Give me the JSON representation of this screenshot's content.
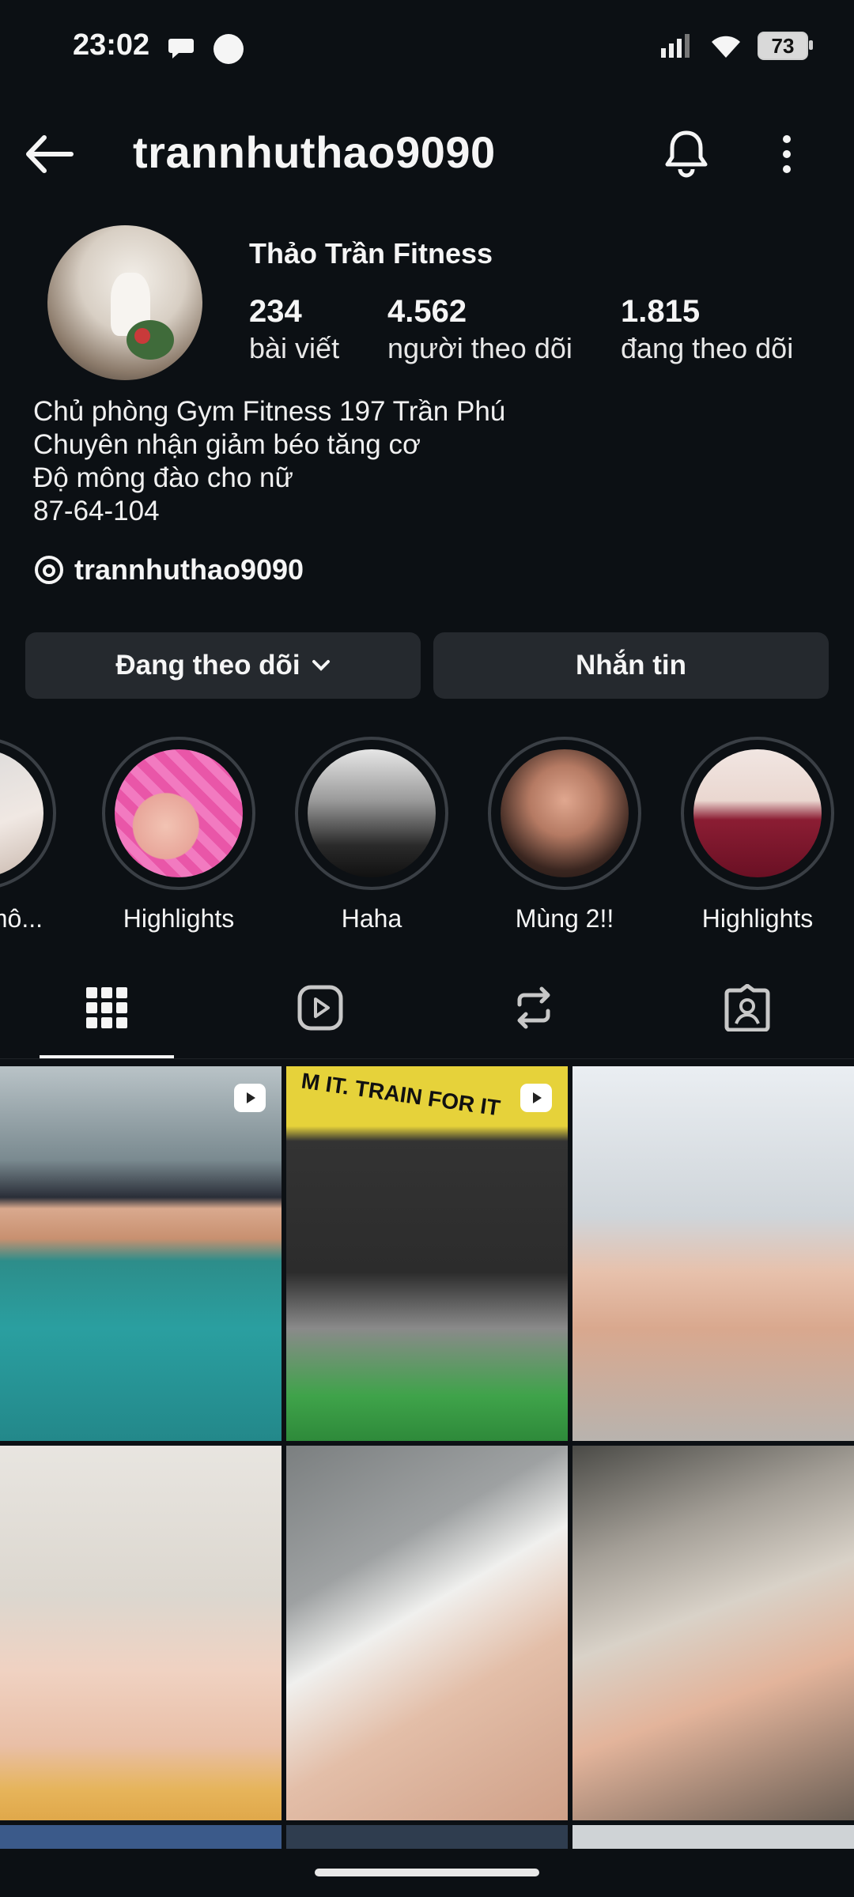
{
  "status_bar": {
    "time": "23:02",
    "battery": "73"
  },
  "header": {
    "username": "trannhuthao9090"
  },
  "profile": {
    "display_name": "Thảo Trần Fitness",
    "stats": [
      {
        "value": "234",
        "label": "bài viết"
      },
      {
        "value": "4.562",
        "label": "người theo dõi"
      },
      {
        "value": "1.815",
        "label": "đang theo dõi"
      }
    ],
    "bio": [
      "Chủ phòng Gym Fitness 197 Trần Phú",
      "Chuyên nhận giảm béo tăng cơ",
      "Độ mông đào cho nữ",
      "87-64-104"
    ],
    "threads_handle": "trannhuthao9090"
  },
  "actions": {
    "following_label": "Đang theo dõi",
    "message_label": "Nhắn tin"
  },
  "highlights": [
    {
      "label": "ở mô..."
    },
    {
      "label": "Highlights"
    },
    {
      "label": "Haha"
    },
    {
      "label": "Mùng 2!!"
    },
    {
      "label": "Highlights"
    }
  ],
  "tabs": [
    {
      "icon": "grid-icon",
      "active": true
    },
    {
      "icon": "reels-icon",
      "active": false
    },
    {
      "icon": "reposts-icon",
      "active": false
    },
    {
      "icon": "tagged-icon",
      "active": false
    }
  ],
  "grid_banner_text": "M IT. TRAIN FOR IT",
  "colors": {
    "background": "#0c1014",
    "button": "#25292e",
    "text": "#f5f5f5"
  }
}
